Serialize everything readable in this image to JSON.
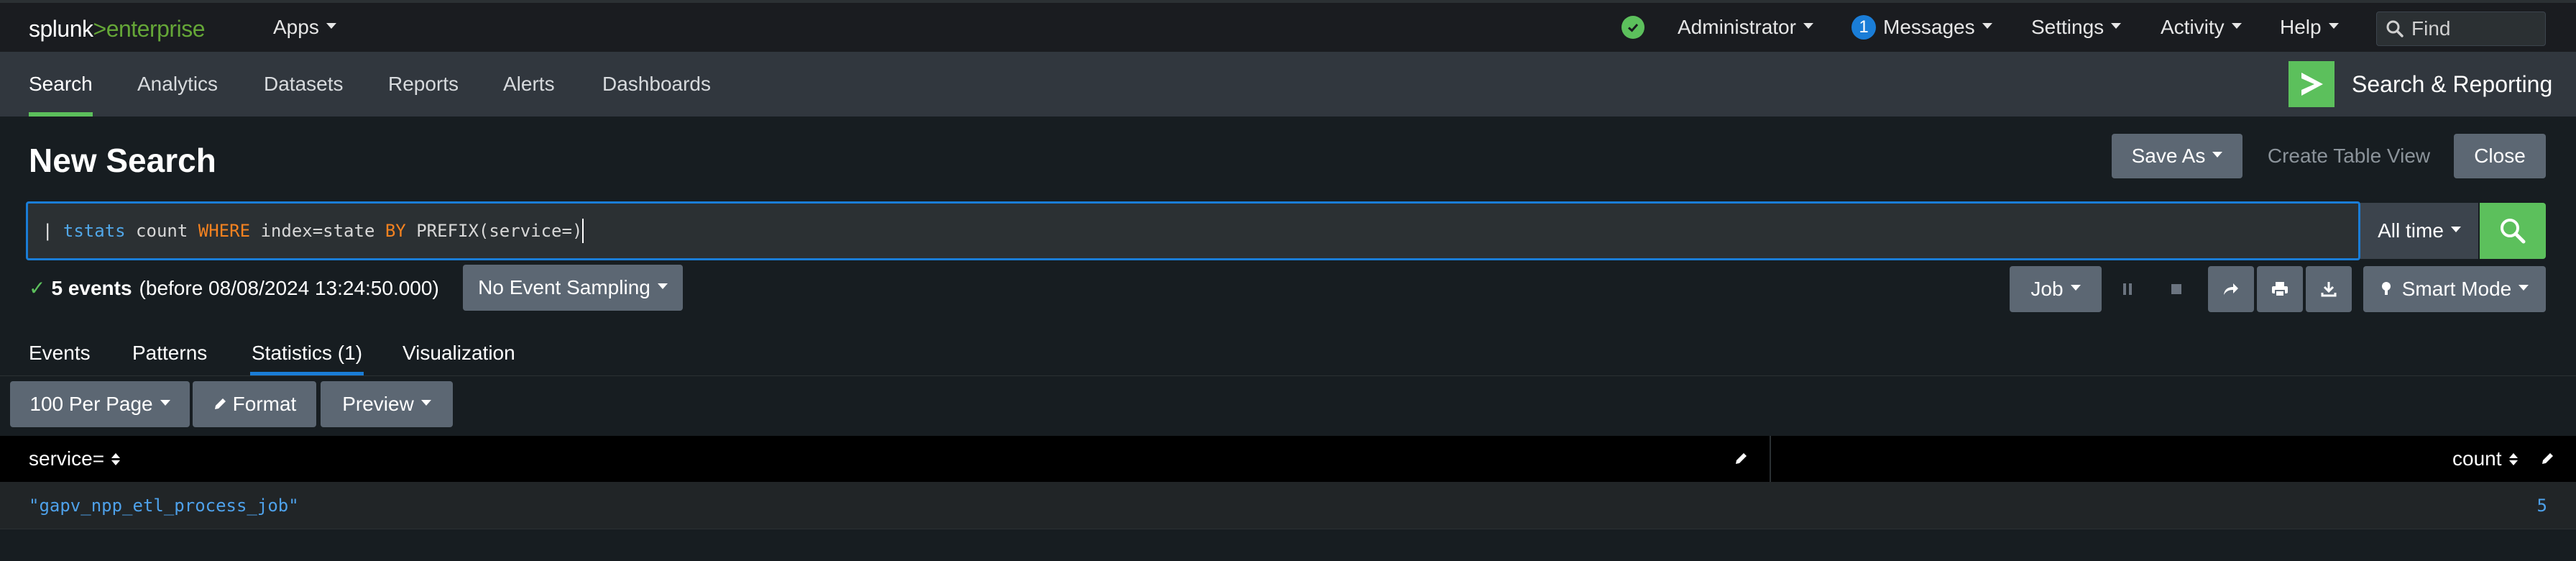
{
  "topbar": {
    "brand_main": "splunk",
    "brand_sep": ">",
    "brand_product": "enterprise",
    "apps_label": "Apps",
    "user_label": "Administrator",
    "messages_count": "1",
    "messages_label": "Messages",
    "settings_label": "Settings",
    "activity_label": "Activity",
    "help_label": "Help",
    "find_placeholder": "Find",
    "status_color": "#5cc05c"
  },
  "appbar": {
    "tabs": [
      {
        "label": "Search",
        "active": true
      },
      {
        "label": "Analytics",
        "active": false
      },
      {
        "label": "Datasets",
        "active": false
      },
      {
        "label": "Reports",
        "active": false
      },
      {
        "label": "Alerts",
        "active": false
      },
      {
        "label": "Dashboards",
        "active": false
      }
    ],
    "app_name": "Search & Reporting",
    "app_icon": "splunk-chevron-icon"
  },
  "page": {
    "title": "New Search",
    "save_as_label": "Save As",
    "create_table_label": "Create Table View",
    "close_label": "Close"
  },
  "search": {
    "query_pipe": "| ",
    "query_cmd": "tstats",
    "query_part1": " count ",
    "query_kw1": "WHERE",
    "query_part2": " index=state ",
    "query_kw2": "BY",
    "query_part3": " PREFIX(service=)",
    "time_range": "All time",
    "submit_icon": "search-icon"
  },
  "status": {
    "events_count": "5 events",
    "events_detail": "(before 08/08/2024 13:24:50.000)",
    "sampling_label": "No Event Sampling",
    "job_label": "Job",
    "mode_label": "Smart Mode"
  },
  "result_tabs": [
    {
      "label": "Events",
      "active": false
    },
    {
      "label": "Patterns",
      "active": false
    },
    {
      "label": "Statistics (1)",
      "active": true
    },
    {
      "label": "Visualization",
      "active": false
    }
  ],
  "table_controls": {
    "per_page_label": "100 Per Page",
    "format_label": "Format",
    "preview_label": "Preview"
  },
  "table": {
    "columns": [
      "service=",
      "count"
    ],
    "rows": [
      [
        "\"gapv_npp_etl_process_job\"",
        "5"
      ]
    ]
  }
}
